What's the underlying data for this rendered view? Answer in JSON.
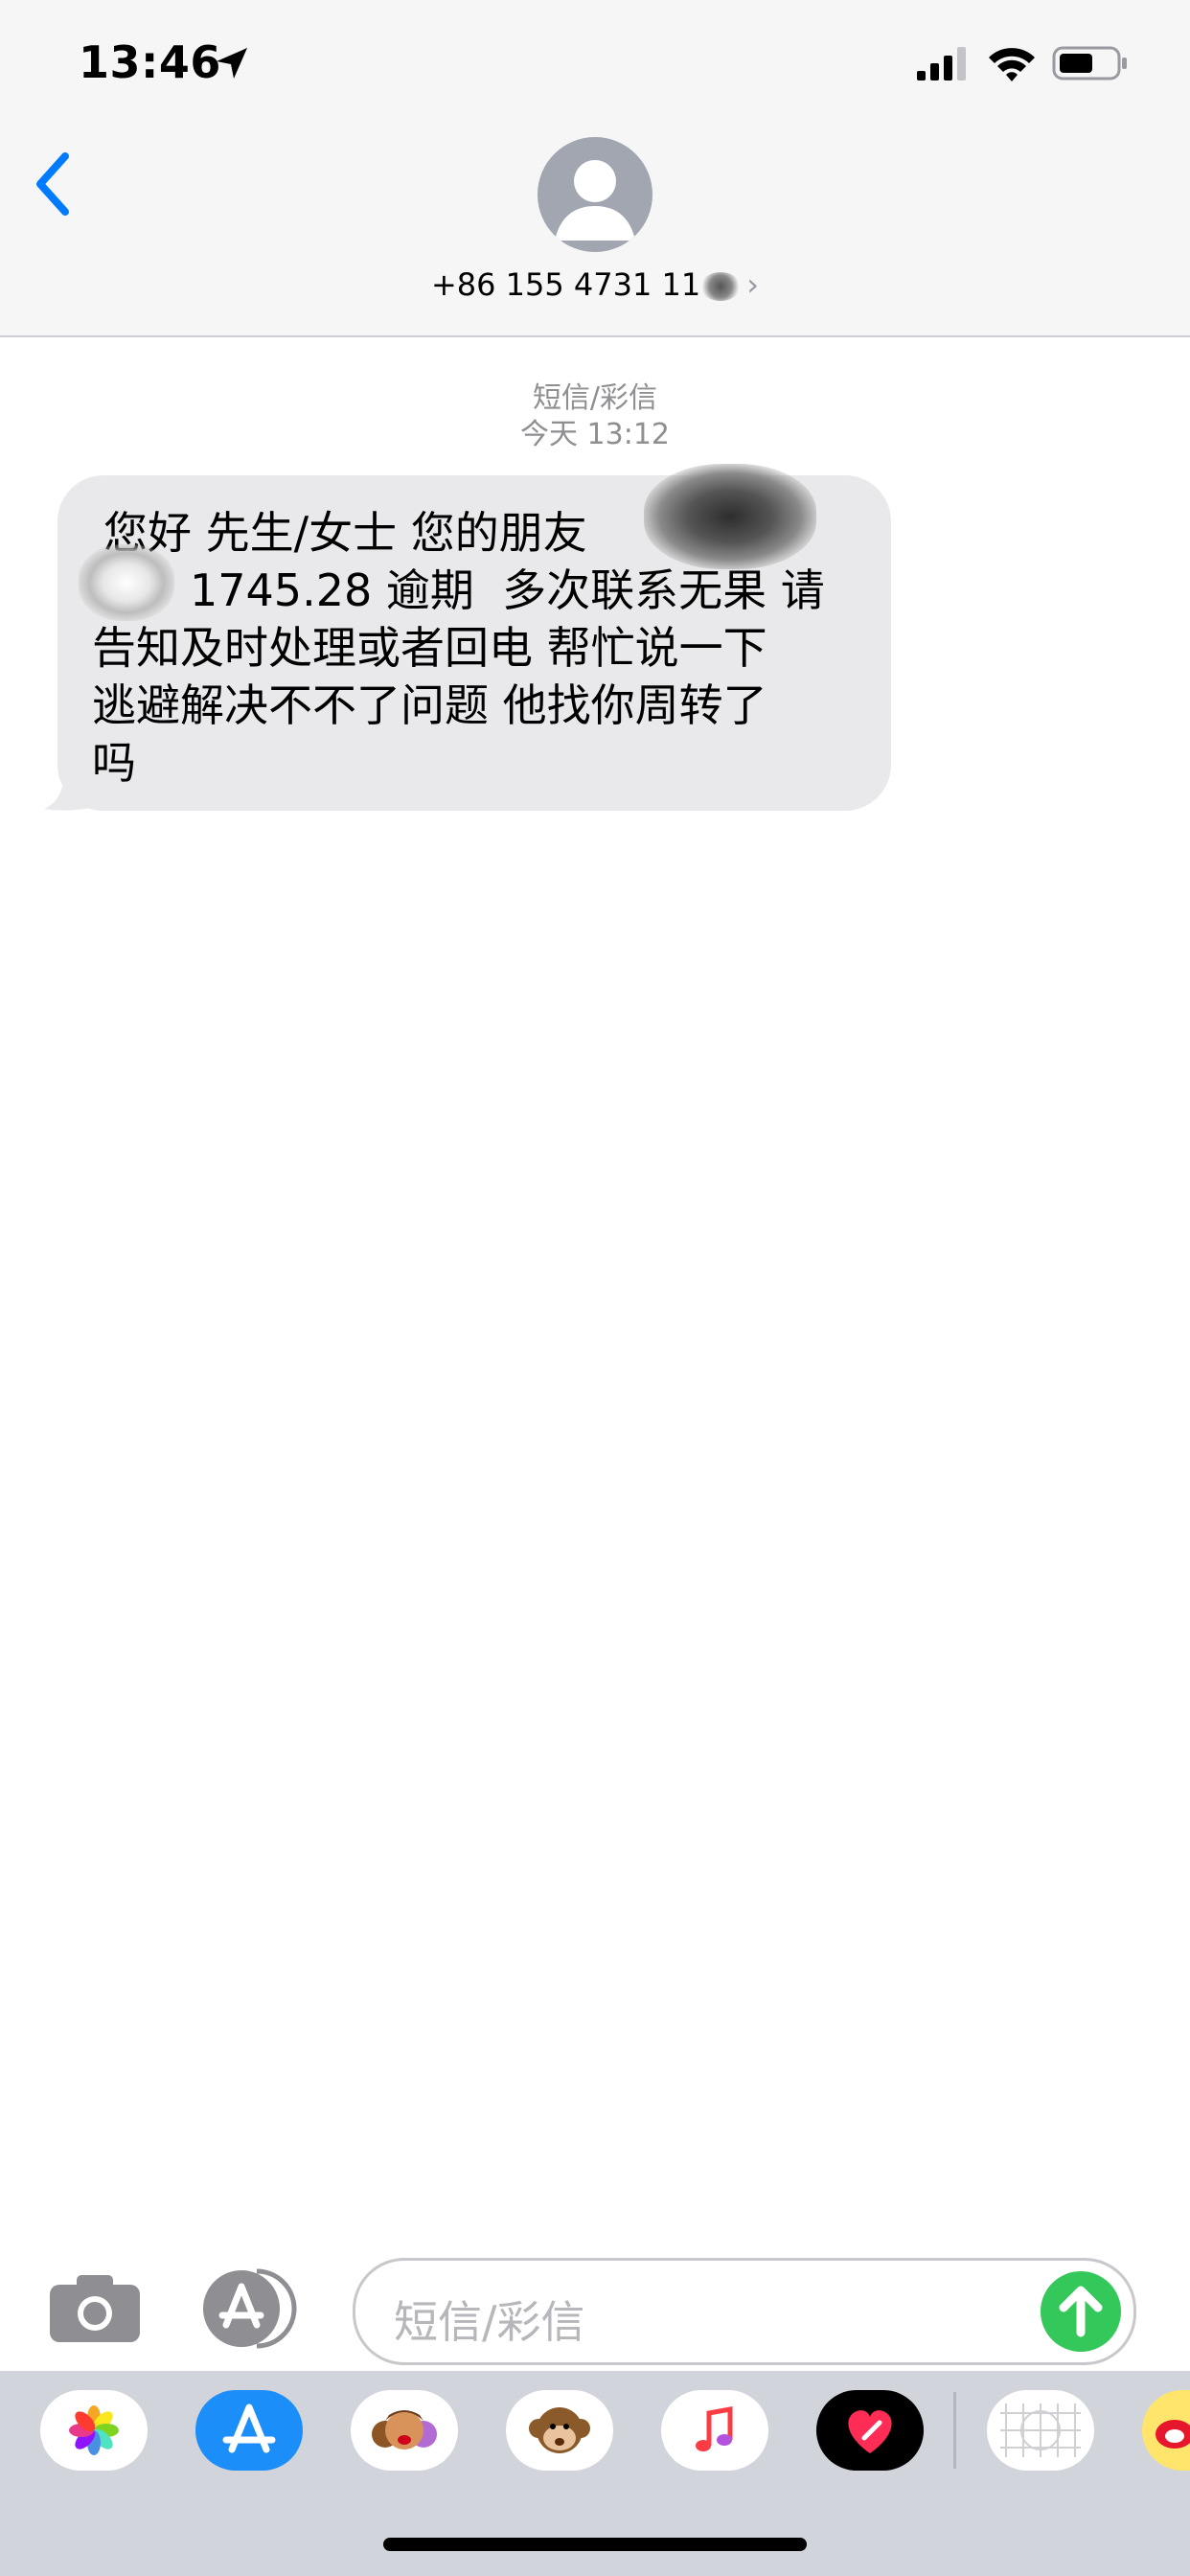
{
  "status_bar": {
    "time": "13:46",
    "icons": [
      "location-arrow-icon",
      "cellular-signal-icon",
      "wifi-icon",
      "battery-icon"
    ]
  },
  "header": {
    "back_icon": "chevron-left-icon",
    "avatar_icon": "person-icon",
    "contact": "+86 155 4731 11"
  },
  "conversation": {
    "type_label": "短信/彩信",
    "timestamp": "今天 13:12",
    "message": {
      "line1": "您好 先生/女士 您的朋友",
      "line2": "1745.28 逾期  多次联系无果 请",
      "line3": "告知及时处理或者回电 帮忙说一下",
      "line4": "逃避解决不不了问题 他找你周转了",
      "line5": "吗"
    }
  },
  "composer": {
    "placeholder": "短信/彩信",
    "camera_icon": "camera-icon",
    "apps_icon": "app-store-icon",
    "send_icon": "arrow-up-icon"
  },
  "app_drawer": {
    "apps": [
      "photos-icon",
      "app-store-icon",
      "memoji-icon",
      "animoji-monkey-icon",
      "music-icon",
      "digital-touch-icon",
      "grid-app-icon",
      "weibo-icon"
    ]
  },
  "colors": {
    "accent": "#007aff",
    "bubble": "#e9e9eb",
    "send": "#34c759",
    "header_bg": "#f6f6f7",
    "drawer_bg": "#d1d4da"
  }
}
